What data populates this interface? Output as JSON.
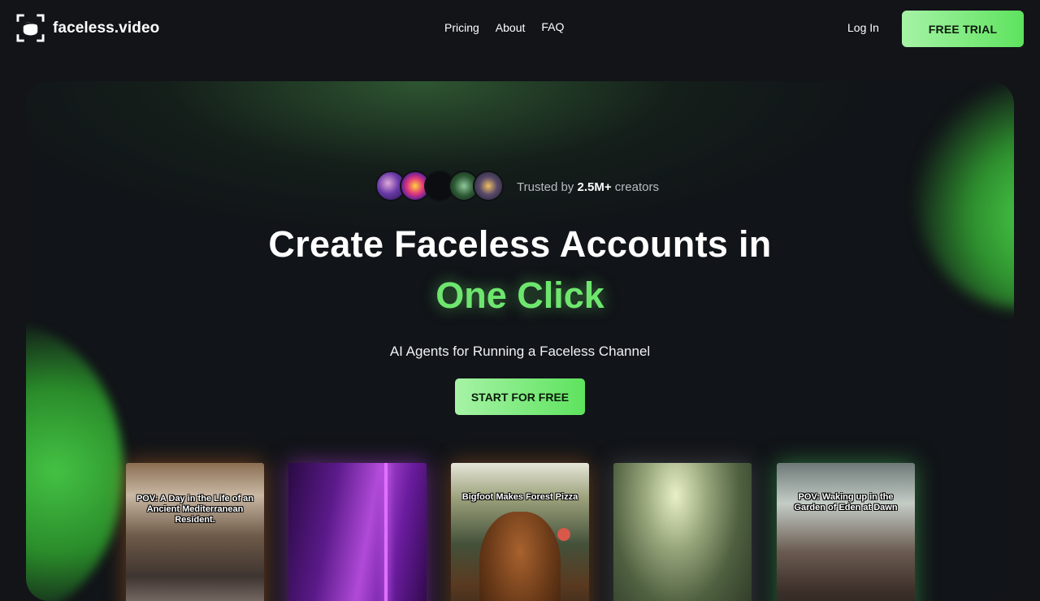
{
  "header": {
    "logo_text": "faceless.video",
    "nav": [
      "Pricing",
      "About",
      "FAQ"
    ],
    "login_label": "Log In",
    "trial_label": "FREE TRIAL"
  },
  "hero": {
    "trusted_prefix": "Trusted by ",
    "trusted_count": "2.5M+",
    "trusted_suffix": " creators",
    "headline": "Create Faceless Accounts in",
    "highlight": "One Click",
    "subtitle": "AI Agents for Running a Faceless Channel",
    "cta_label": "START FOR FREE"
  },
  "videos": [
    {
      "caption": "POV: A Day in the Life of an Ancient Mediterranean Resident."
    },
    {
      "caption": ""
    },
    {
      "caption": "Bigfoot Makes Forest Pizza"
    },
    {
      "caption": ""
    },
    {
      "caption": "POV: Waking up in the Garden of Eden at Dawn"
    }
  ],
  "colors": {
    "background": "#121418",
    "accent": "#6ee66e",
    "button_gradient_start": "#a6f3a6",
    "button_gradient_end": "#5ee35e"
  }
}
